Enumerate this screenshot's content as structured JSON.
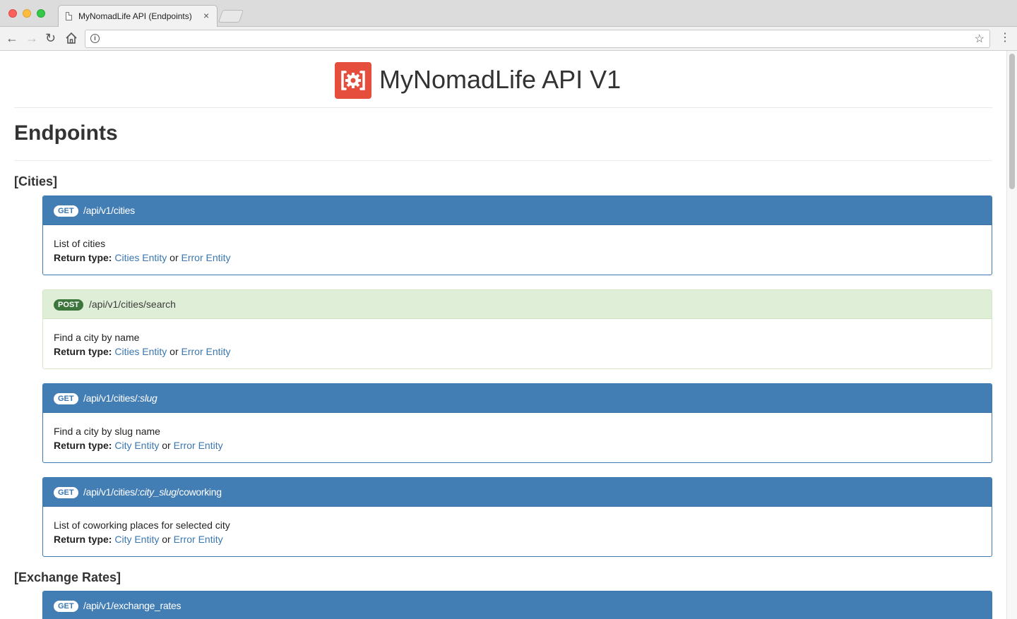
{
  "browser": {
    "tab_title": "MyNomadLife API (Endpoints)",
    "tab_close": "×",
    "url": ""
  },
  "header": {
    "title": "MyNomadLife API V1"
  },
  "page": {
    "heading": "Endpoints"
  },
  "sections": [
    {
      "title": "[Cities]",
      "endpoints": [
        {
          "method": "GET",
          "path_parts": [
            "/api/v1/cities"
          ],
          "description": "List of cities",
          "return_label": "Return type:",
          "return_primary": "Cities Entity",
          "return_or": "or",
          "return_error": "Error Entity"
        },
        {
          "method": "POST",
          "path_parts": [
            "/api/v1/cities/search"
          ],
          "description": "Find a city by name",
          "return_label": "Return type:",
          "return_primary": "Cities Entity",
          "return_or": "or",
          "return_error": "Error Entity"
        },
        {
          "method": "GET",
          "path_parts": [
            "/api/v1/cities/",
            ":slug"
          ],
          "description": "Find a city by slug name",
          "return_label": "Return type:",
          "return_primary": "City Entity",
          "return_or": "or",
          "return_error": "Error Entity"
        },
        {
          "method": "GET",
          "path_parts": [
            "/api/v1/cities/",
            ":city_slug",
            "/coworking"
          ],
          "description": "List of coworking places for selected city",
          "return_label": "Return type:",
          "return_primary": "City Entity",
          "return_or": "or",
          "return_error": "Error Entity"
        }
      ]
    },
    {
      "title": "[Exchange Rates]",
      "endpoints": [
        {
          "method": "GET",
          "path_parts": [
            "/api/v1/exchange_rates"
          ]
        }
      ]
    }
  ],
  "colors": {
    "get_header": "#427db4",
    "post_header": "#dfeed6",
    "post_badge": "#3c763d",
    "link": "#3a77b0",
    "logo": "#e54d3c"
  }
}
